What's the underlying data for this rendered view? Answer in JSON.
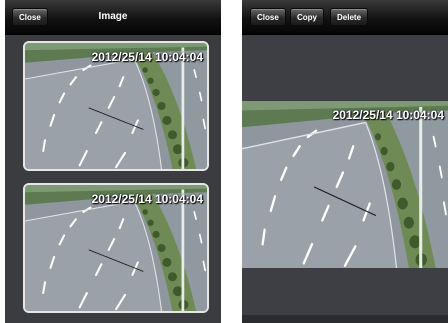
{
  "gallery": {
    "close_label": "Close",
    "title": "Image",
    "thumbnails": [
      {
        "timestamp": "2012/25/14 10:04:04",
        "image": "highway-camera-snapshot"
      },
      {
        "timestamp": "2012/25/14 10:04:04",
        "image": "highway-camera-snapshot"
      }
    ]
  },
  "viewer": {
    "close_label": "Close",
    "copy_label": "Copy",
    "delete_label": "Delete",
    "timestamp": "2012/25/14 10:04:04",
    "image": "highway-camera-snapshot"
  },
  "colors": {
    "navbar": "#0d0d0d",
    "background": "#3a3c40",
    "thumbnail_border": "#e6e6e6"
  }
}
